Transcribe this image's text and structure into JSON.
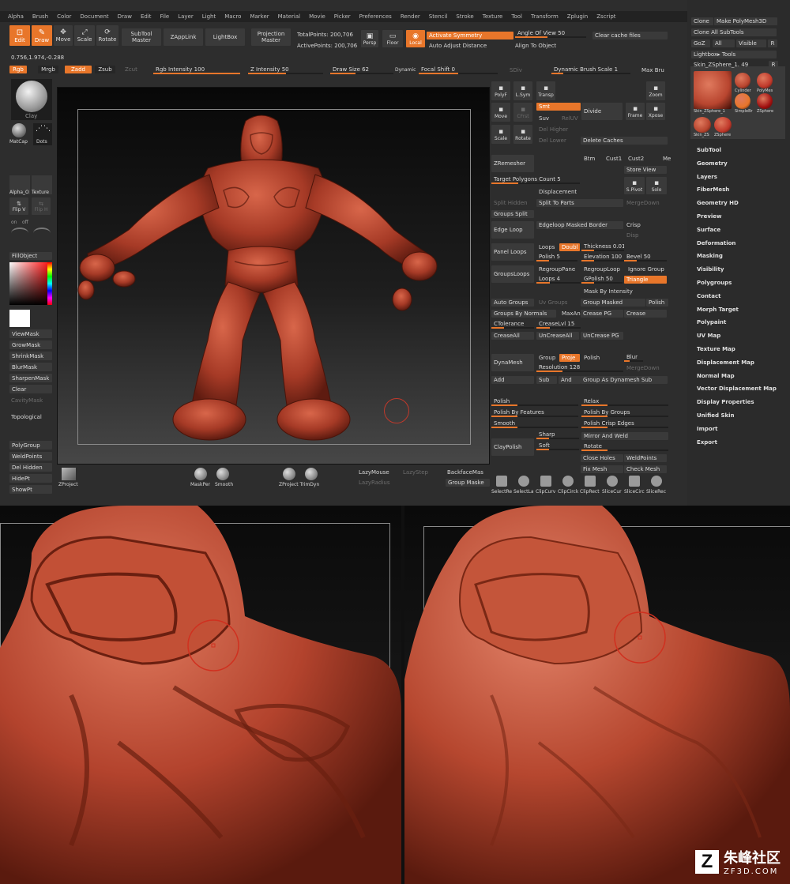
{
  "menu": [
    "Alpha",
    "Brush",
    "Color",
    "Document",
    "Draw",
    "Edit",
    "File",
    "Layer",
    "Light",
    "Macro",
    "Marker",
    "Material",
    "Movie",
    "Picker",
    "Preferences",
    "Render",
    "Stencil",
    "Stroke",
    "Texture",
    "Tool",
    "Transform",
    "Zplugin",
    "Zscript"
  ],
  "coords": "0.756,1.974,-0.288",
  "toolbar": {
    "edit": "Edit",
    "draw": "Draw",
    "move": "Move",
    "scale": "Scale",
    "rotate": "Rotate",
    "subtool_master": "SubTool Master",
    "zapplink": "ZAppLink",
    "lightbox": "LightBox",
    "projection_master": "Projection Master",
    "total_points": "TotalPoints: 200,706",
    "active_points": "ActivePoints: 200,706",
    "persp": "Persp",
    "floor": "Floor",
    "local": "Local",
    "activate_symmetry": "Activate Symmetry",
    "auto_adjust": "Auto Adjust Distance",
    "angle_of_view": "Angle Of View 50",
    "align_to_object": "Align To Object",
    "clear_cache": "Clear cache files"
  },
  "row2": {
    "rgb": "Rgb",
    "mrgb": "Mrgb",
    "zadd": "Zadd",
    "zsub": "Zsub",
    "zcut": "Zcut",
    "rgb_intensity": "Rgb Intensity 100",
    "z_intensity": "Z Intensity 50",
    "draw_size": "Draw Size 62",
    "dynamic": "Dynamic",
    "focal_shift": "Focal Shift 0",
    "sdiv": "SDiv",
    "dynamic_brush_scale": "Dynamic Brush Scale 1",
    "max_brush": "Max Bru"
  },
  "left_shelf": {
    "clay": "Clay",
    "matcap": "MatCap",
    "dots": "Dots",
    "alpha": "Alpha_O",
    "texture": "Texture",
    "flip_v": "Flip V",
    "flip_h": "Flip H",
    "on": "on",
    "off": "off",
    "fill_object": "FillObject",
    "mask_items": [
      "ViewMask",
      "GrowMask",
      "ShrinkMask",
      "BlurMask",
      "SharpenMask",
      "Clear"
    ],
    "cavity_mask": "CavityMask",
    "topological": "Topological",
    "bottom_items": [
      "PolyGroup",
      "WeldPoints",
      "Del Hidden",
      "HidePt",
      "ShowPt"
    ]
  },
  "canvas_bottom": {
    "zproject": "ZProject",
    "maskper": "MaskPer",
    "smooth": "Smooth",
    "zproject_trimdyn": "ZProject TrimDyn",
    "lazymouse": "LazyMouse",
    "lazystep": "LazyStep",
    "lazyradius": "LazyRadius",
    "backface": "BackfaceMas",
    "group_mask": "Group Maske"
  },
  "geometry": {
    "polyf": "PolyF",
    "lsym": "L.Sym",
    "transp": "Transp",
    "zoom": "Zoom",
    "move": "Move",
    "cfrst": "CFrst",
    "scale": "Scale",
    "rotate": "Rotate",
    "smt": "Smt",
    "suv": "Suv",
    "reuv": "RelUV",
    "divide": "Divide",
    "frame": "Frame",
    "xpose": "Xpose",
    "del_higher": "Del Higher",
    "del_lower": "Del Lower",
    "delete_caches": "Delete Caches",
    "zremesher": "ZRemesher",
    "btm": "Btm",
    "cust1": "Cust1",
    "cust2": "Cust2",
    "me": "Me",
    "store_view": "Store View",
    "target_polygons": "Target Polygons Count 5",
    "displacement": "Displacement",
    "spivot": "S.Pivot",
    "solo": "Solo",
    "dynamic": "Dynamic",
    "split_hidden": "Split Hidden",
    "split_to_parts": "Split To Parts",
    "merge_down": "MergeDown",
    "groups_split": "Groups Split",
    "edge_loop": "Edge Loop",
    "edgeloop_masked": "Edgeloop Masked Border",
    "crisp": "Crisp",
    "disp": "Disp",
    "panel_loops": "Panel Loops",
    "loops": "Loops",
    "double": "Doubl",
    "thickness": "Thickness 0.01",
    "polish5": "Polish 5",
    "elevation": "Elevation 100",
    "bevel": "Bevel 50",
    "groups_loops": "GroupsLoops",
    "regroup_panel": "RegroupPane",
    "regroup_loop": "RegroupLoop",
    "ignore_groups": "Ignore Group",
    "loops4": "Loops 4",
    "gpolish": "GPolish 50",
    "triangle": "Triangle",
    "mask_by_intensity": "Mask By Intensity",
    "auto_groups": "Auto Groups",
    "uv_groups": "Uv Groups",
    "group_masked": "Group Masked",
    "polish": "Polish",
    "groups_by_normals": "Groups By Normals",
    "maxang": "MaxAn",
    "crease_pg": "Crease PG",
    "crease": "Crease",
    "ctolerance": "CTolerance",
    "creaselvl": "CreaseLvl 15",
    "crease_all": "CreaseAll",
    "uncrease_all": "UnCreaseAll",
    "uncrease_pg": "UnCrease PG",
    "dynamesh": "DynaMesh",
    "group": "Group",
    "project": "Proje",
    "polish_dm": "Polish",
    "blur": "Blur",
    "resolution": "Resolution 128",
    "merge_down2": "MergeDown",
    "add": "Add",
    "sub": "Sub",
    "and": "And",
    "group_as_dynamesh": "Group As Dynamesh Sub",
    "polish_zm": "Polish",
    "relax": "Relax",
    "polish_by_features": "Polish By Features",
    "polish_by_groups": "Polish By Groups",
    "smooth": "Smooth",
    "polish_crisp": "Polish Crisp Edges",
    "claypolish": "ClayPolish",
    "sharp": "Sharp",
    "soft": "Soft",
    "mirror_weld": "Mirror And Weld",
    "rotate2": "Rotate",
    "close_holes": "Close Holes",
    "weld_points": "WeldPoints",
    "fix_mesh": "Fix Mesh",
    "check_mesh": "Check Mesh",
    "icons_bottom": [
      "SelectRe",
      "SelectLa",
      "ClipCurv",
      "ClipCirck",
      "ClipRect",
      "SliceCur",
      "SliceCirc",
      "SliceRec"
    ]
  },
  "tool_panel": {
    "clone": "Clone",
    "make_polymesh": "Make PolyMesh3D",
    "clone_all": "Clone All SubTools",
    "goz": "GoZ",
    "all": "All",
    "visible": "Visible",
    "r": "R",
    "lightbox_tools": "Lightbox▸ Tools",
    "current_tool": "Skin_ZSphere_1. 49",
    "thumbs": [
      "Skin_ZSphere_1",
      "Cylinder",
      "PolyMes",
      "SimpleBr",
      "ZSphere",
      "Skin_ZS",
      "ZSphere"
    ],
    "menu": [
      "SubTool",
      "Geometry",
      "Layers",
      "FiberMesh",
      "Geometry HD",
      "Preview",
      "Surface",
      "Deformation",
      "Masking",
      "Visibility",
      "Polygroups",
      "Contact",
      "Morph Target",
      "Polypaint",
      "UV Map",
      "Texture Map",
      "Displacement Map",
      "Normal Map",
      "Vector Displacement Map",
      "Display Properties",
      "Unified Skin",
      "Import",
      "Export"
    ]
  },
  "watermark": {
    "name": "朱峰社区",
    "site": "ZF3D.COM"
  },
  "colors": {
    "accent": "#e8762a",
    "clay": "#b8452f",
    "panel": "#2d2d2d",
    "button": "#3a3a3a"
  }
}
